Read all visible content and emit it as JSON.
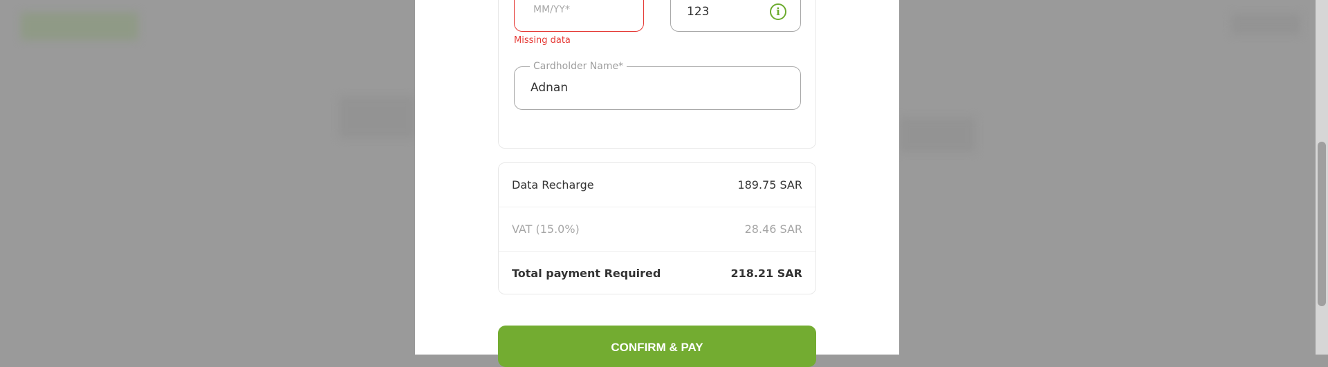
{
  "payment_form": {
    "expiry": {
      "placeholder": "MM/YY*",
      "error": "Missing data"
    },
    "cvv": {
      "value": "123",
      "icon": "info-icon"
    },
    "cardholder": {
      "label": "Cardholder Name*",
      "value": "Adnan"
    }
  },
  "summary": {
    "rows": [
      {
        "label": "Data Recharge",
        "value": "189.75 SAR"
      },
      {
        "label": "VAT (15.0%)",
        "value": "28.46 SAR"
      },
      {
        "label": "Total payment Required",
        "value": "218.21 SAR"
      }
    ]
  },
  "actions": {
    "confirm_label": "CONFIRM & PAY"
  },
  "colors": {
    "accent": "#73ac31",
    "error": "#e53935",
    "overlay": "#9a9a9a"
  }
}
